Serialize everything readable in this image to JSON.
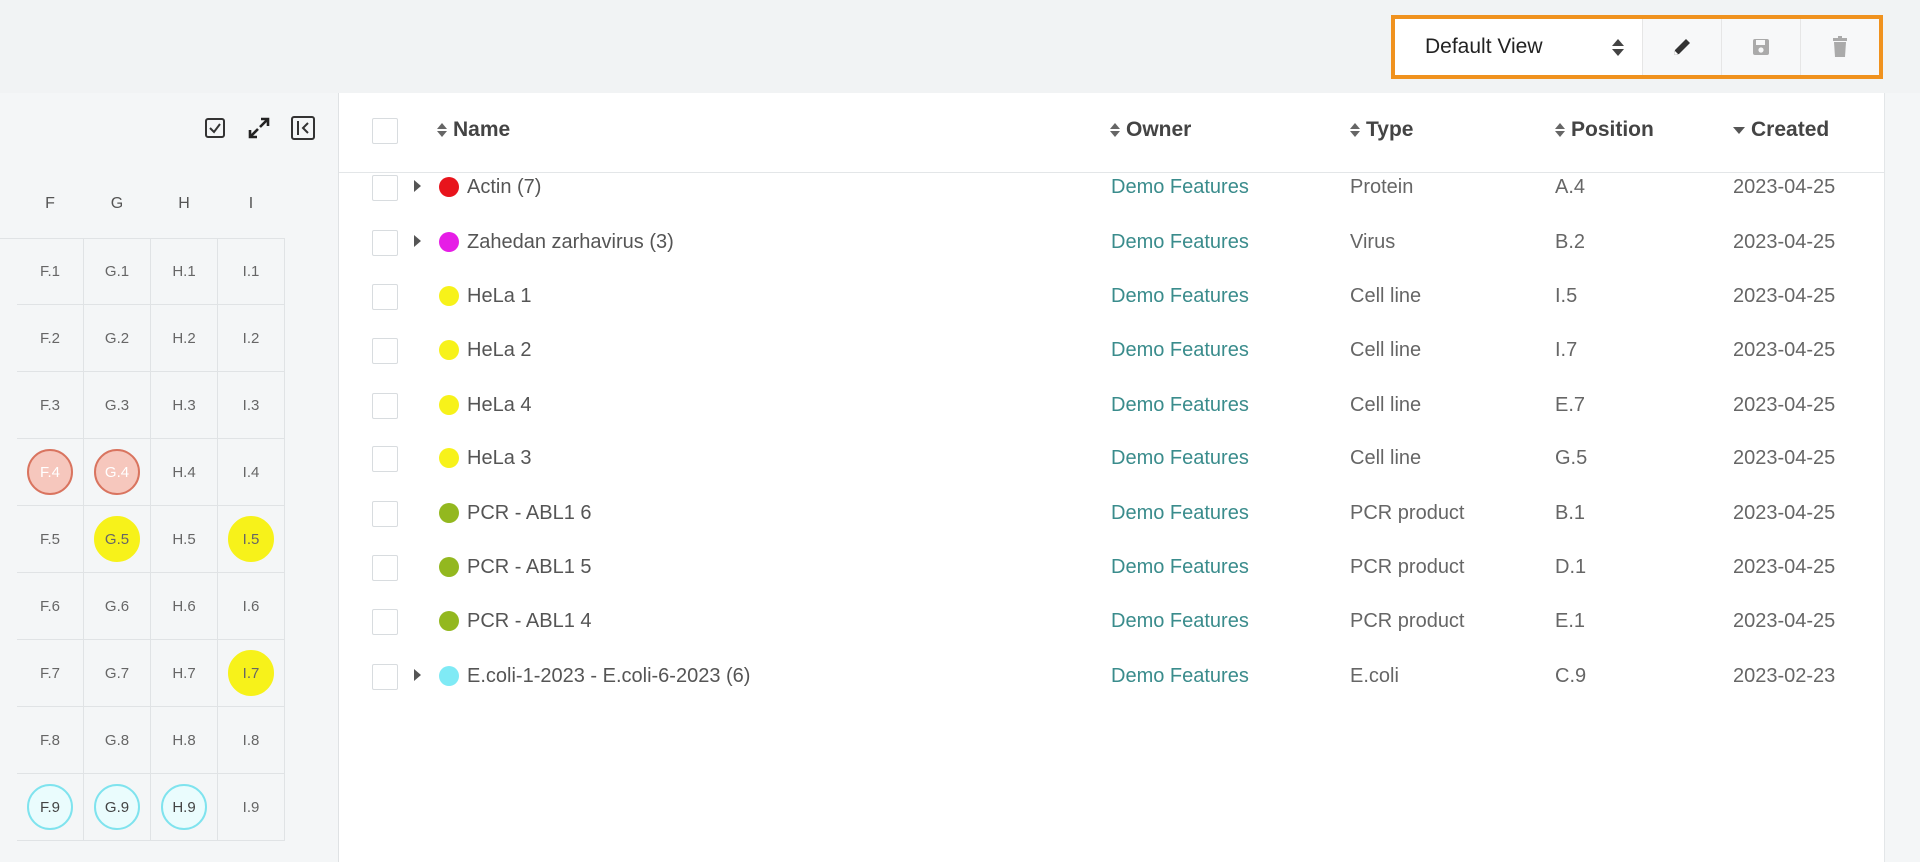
{
  "toolbar": {
    "view_select": "Default View",
    "icons": {
      "edit": "pencil-icon",
      "save": "save-icon",
      "delete": "trash-icon"
    }
  },
  "plate": {
    "tool_icons": [
      "checkbox-icon",
      "expand-icon",
      "collapse-panel-icon"
    ],
    "columns": [
      "F",
      "G",
      "H",
      "I"
    ],
    "rows": [
      [
        {
          "label": "F.1"
        },
        {
          "label": "G.1"
        },
        {
          "label": "H.1"
        },
        {
          "label": "I.1"
        }
      ],
      [
        {
          "label": "F.2"
        },
        {
          "label": "G.2"
        },
        {
          "label": "H.2"
        },
        {
          "label": "I.2"
        }
      ],
      [
        {
          "label": "F.3"
        },
        {
          "label": "G.3"
        },
        {
          "label": "H.3"
        },
        {
          "label": "I.3"
        }
      ],
      [
        {
          "label": "F.4",
          "fill": "#f6c7bd",
          "stroke": "#d9745f",
          "text": "#fff"
        },
        {
          "label": "G.4",
          "fill": "#f6c7bd",
          "stroke": "#d9745f",
          "text": "#fff"
        },
        {
          "label": "H.4"
        },
        {
          "label": "I.4"
        }
      ],
      [
        {
          "label": "F.5"
        },
        {
          "label": "G.5",
          "fill": "#f7f21a",
          "stroke": "#f7f21a",
          "text": "#666"
        },
        {
          "label": "H.5"
        },
        {
          "label": "I.5",
          "fill": "#f7f21a",
          "stroke": "#f7f21a",
          "text": "#666"
        }
      ],
      [
        {
          "label": "F.6"
        },
        {
          "label": "G.6"
        },
        {
          "label": "H.6"
        },
        {
          "label": "I.6"
        }
      ],
      [
        {
          "label": "F.7"
        },
        {
          "label": "G.7"
        },
        {
          "label": "H.7"
        },
        {
          "label": "I.7",
          "fill": "#f7f21a",
          "stroke": "#f7f21a",
          "text": "#666"
        }
      ],
      [
        {
          "label": "F.8"
        },
        {
          "label": "G.8"
        },
        {
          "label": "H.8"
        },
        {
          "label": "I.8"
        }
      ],
      [
        {
          "label": "F.9",
          "fill": "#eafcfd",
          "stroke": "#7fe3ee",
          "text": "#444"
        },
        {
          "label": "G.9",
          "fill": "#eafcfd",
          "stroke": "#7fe3ee",
          "text": "#444"
        },
        {
          "label": "H.9",
          "fill": "#eafcfd",
          "stroke": "#7fe3ee",
          "text": "#444"
        },
        {
          "label": "I.9"
        }
      ]
    ]
  },
  "table": {
    "headers": {
      "name": "Name",
      "owner": "Owner",
      "type": "Type",
      "position": "Position",
      "created": "Created"
    },
    "rows": [
      {
        "name": "Actin (7)",
        "owner": "Demo Features",
        "type": "Protein",
        "position": "A.4",
        "created": "2023-04-25",
        "color": "#e8141c",
        "expandable": true
      },
      {
        "name": "Zahedan zarhavirus (3)",
        "owner": "Demo Features",
        "type": "Virus",
        "position": "B.2",
        "created": "2023-04-25",
        "color": "#e61de6",
        "expandable": true
      },
      {
        "name": "HeLa 1",
        "owner": "Demo Features",
        "type": "Cell line",
        "position": "I.5",
        "created": "2023-04-25",
        "color": "#f7f21a",
        "expandable": false
      },
      {
        "name": "HeLa 2",
        "owner": "Demo Features",
        "type": "Cell line",
        "position": "I.7",
        "created": "2023-04-25",
        "color": "#f7f21a",
        "expandable": false
      },
      {
        "name": "HeLa 4",
        "owner": "Demo Features",
        "type": "Cell line",
        "position": "E.7",
        "created": "2023-04-25",
        "color": "#f7f21a",
        "expandable": false
      },
      {
        "name": "HeLa 3",
        "owner": "Demo Features",
        "type": "Cell line",
        "position": "G.5",
        "created": "2023-04-25",
        "color": "#f7f21a",
        "expandable": false
      },
      {
        "name": "PCR - ABL1 6",
        "owner": "Demo Features",
        "type": "PCR product",
        "position": "B.1",
        "created": "2023-04-25",
        "color": "#93b81f",
        "expandable": false
      },
      {
        "name": "PCR - ABL1 5",
        "owner": "Demo Features",
        "type": "PCR product",
        "position": "D.1",
        "created": "2023-04-25",
        "color": "#93b81f",
        "expandable": false
      },
      {
        "name": "PCR - ABL1 4",
        "owner": "Demo Features",
        "type": "PCR product",
        "position": "E.1",
        "created": "2023-04-25",
        "color": "#93b81f",
        "expandable": false
      },
      {
        "name": "E.coli-1-2023 - E.coli-6-2023 (6)",
        "owner": "Demo Features",
        "type": "E.coli",
        "position": "C.9",
        "created": "2023-02-23",
        "color": "#7feaf5",
        "expandable": true
      }
    ]
  }
}
